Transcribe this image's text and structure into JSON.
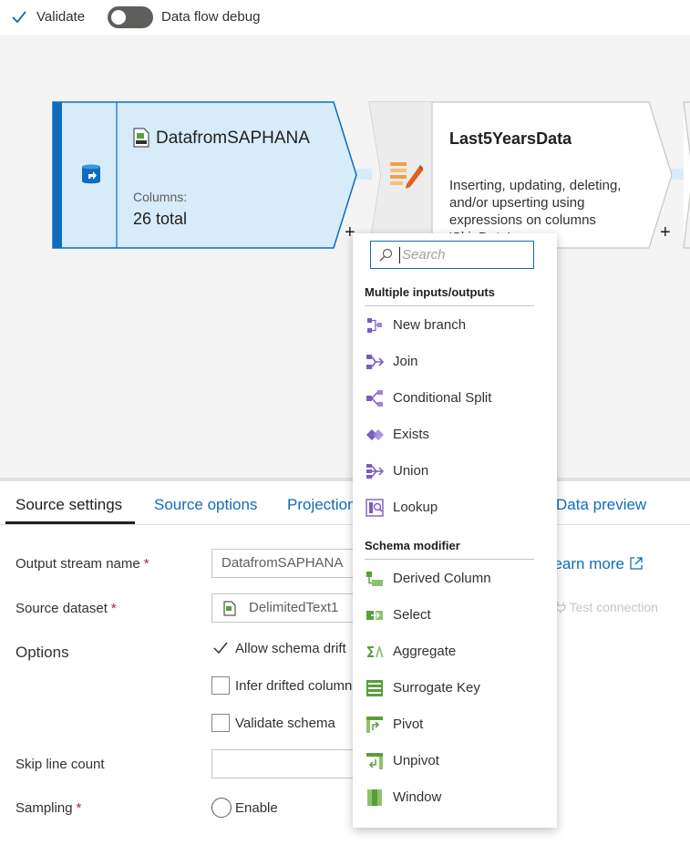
{
  "toolbar": {
    "validate_label": "Validate",
    "debug_label": "Data flow debug"
  },
  "nodes": {
    "source": {
      "title": "DatafromSAPHANA",
      "columns_label": "Columns:",
      "columns_value": "26 total"
    },
    "sink": {
      "title": "Last5YearsData",
      "description": "Inserting, updating, deleting, and/or upserting using expressions on columns 'SkipData'"
    }
  },
  "tabs": [
    "Source settings",
    "Source options",
    "Projection",
    "Data preview"
  ],
  "form": {
    "output_stream_label": "Output stream name",
    "output_stream_value": "DatafromSAPHANA",
    "source_dataset_label": "Source dataset",
    "source_dataset_value": "DelimitedText1",
    "options_label": "Options",
    "allow_schema_drift": "Allow schema drift",
    "infer_drifted": "Infer drifted column types",
    "validate_schema": "Validate schema",
    "skip_line_label": "Skip line count",
    "sampling_label": "Sampling",
    "enable_label": "Enable",
    "learn_more": "Learn more",
    "test_connection": "Test connection",
    "required_mark": "*"
  },
  "menu": {
    "search_placeholder": "Search",
    "section1": "Multiple inputs/outputs",
    "items1": [
      "New branch",
      "Join",
      "Conditional Split",
      "Exists",
      "Union",
      "Lookup"
    ],
    "section2": "Schema modifier",
    "items2": [
      "Derived Column",
      "Select",
      "Aggregate",
      "Surrogate Key",
      "Pivot",
      "Unpivot",
      "Window"
    ]
  },
  "colors": {
    "accent": "#0f6cbd",
    "source_node": "#d6ecfa",
    "purple_icon": "#7b5cc0",
    "green_icon": "#5a9e3a"
  }
}
